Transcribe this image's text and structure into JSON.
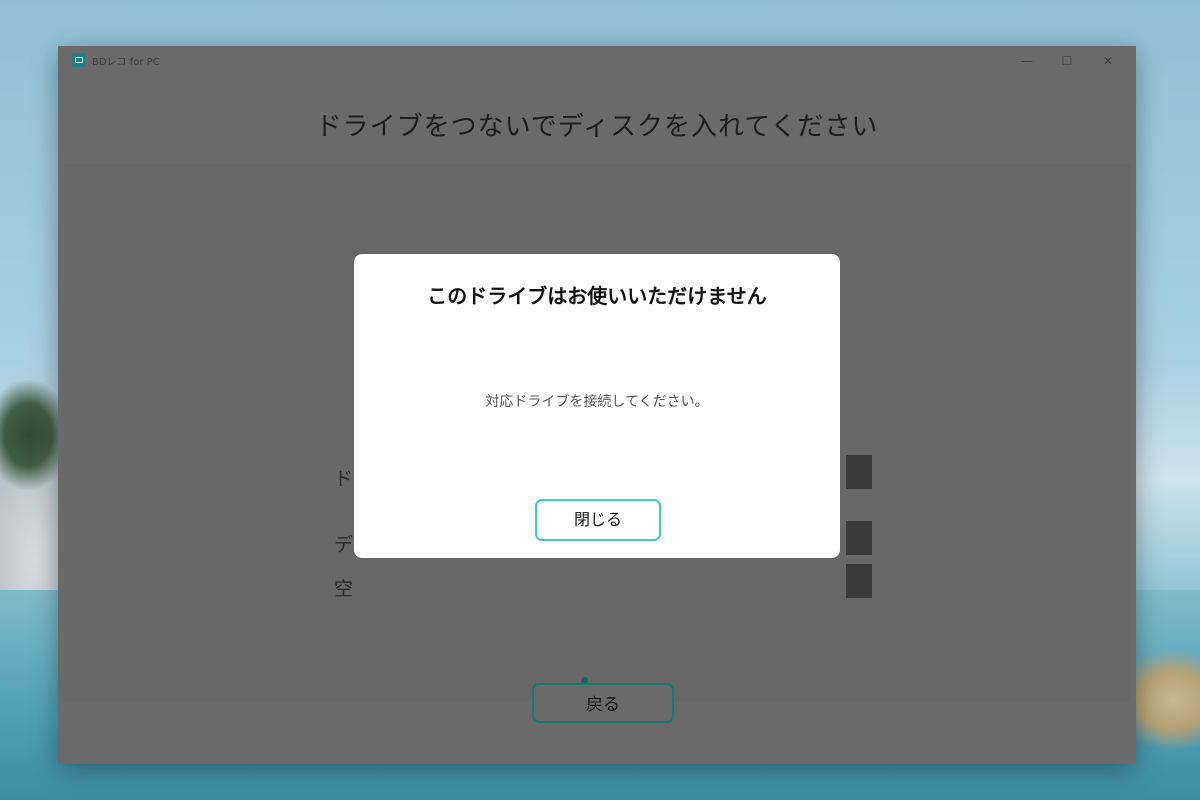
{
  "window": {
    "title": "BDレコ for PC",
    "controls": {
      "minimize": "—",
      "maximize": "☐",
      "close": "✕"
    }
  },
  "main": {
    "heading": "ドライブをつないでディスクを入れてください",
    "rows": [
      {
        "label": "ド"
      },
      {
        "label": "デ"
      },
      {
        "label": "空"
      }
    ],
    "back_label": "戻る"
  },
  "dialog": {
    "title": "このドライブはお使いいただけません",
    "message": "対応ドライブを接続してください。",
    "close_label": "閉じる"
  },
  "colors": {
    "accent": "#3fcdb4",
    "accent_dark": "#157a6c",
    "overlay": "#6a6a6a"
  }
}
